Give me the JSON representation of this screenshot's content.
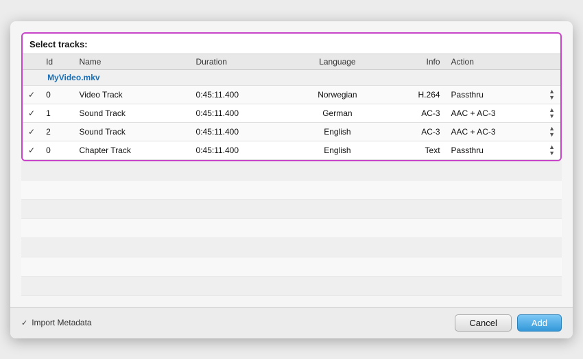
{
  "dialog": {
    "title": "Select tracks:",
    "table": {
      "columns": [
        "",
        "Id",
        "Name",
        "Duration",
        "Language",
        "Info",
        "Action"
      ],
      "file_row": {
        "filename": "MyVideo.mkv"
      },
      "rows": [
        {
          "checked": true,
          "id": "0",
          "name": "Video Track",
          "duration": "0:45:11.400",
          "language": "Norwegian",
          "info": "H.264",
          "action": "Passthru"
        },
        {
          "checked": true,
          "id": "1",
          "name": "Sound Track",
          "duration": "0:45:11.400",
          "language": "German",
          "info": "AC-3",
          "action": "AAC + AC-3"
        },
        {
          "checked": true,
          "id": "2",
          "name": "Sound Track",
          "duration": "0:45:11.400",
          "language": "English",
          "info": "AC-3",
          "action": "AAC + AC-3"
        },
        {
          "checked": true,
          "id": "0",
          "name": "Chapter Track",
          "duration": "0:45:11.400",
          "language": "English",
          "info": "Text",
          "action": "Passthru"
        }
      ]
    },
    "footer": {
      "import_metadata_label": "Import Metadata",
      "import_metadata_checked": true,
      "cancel_button": "Cancel",
      "add_button": "Add"
    }
  }
}
